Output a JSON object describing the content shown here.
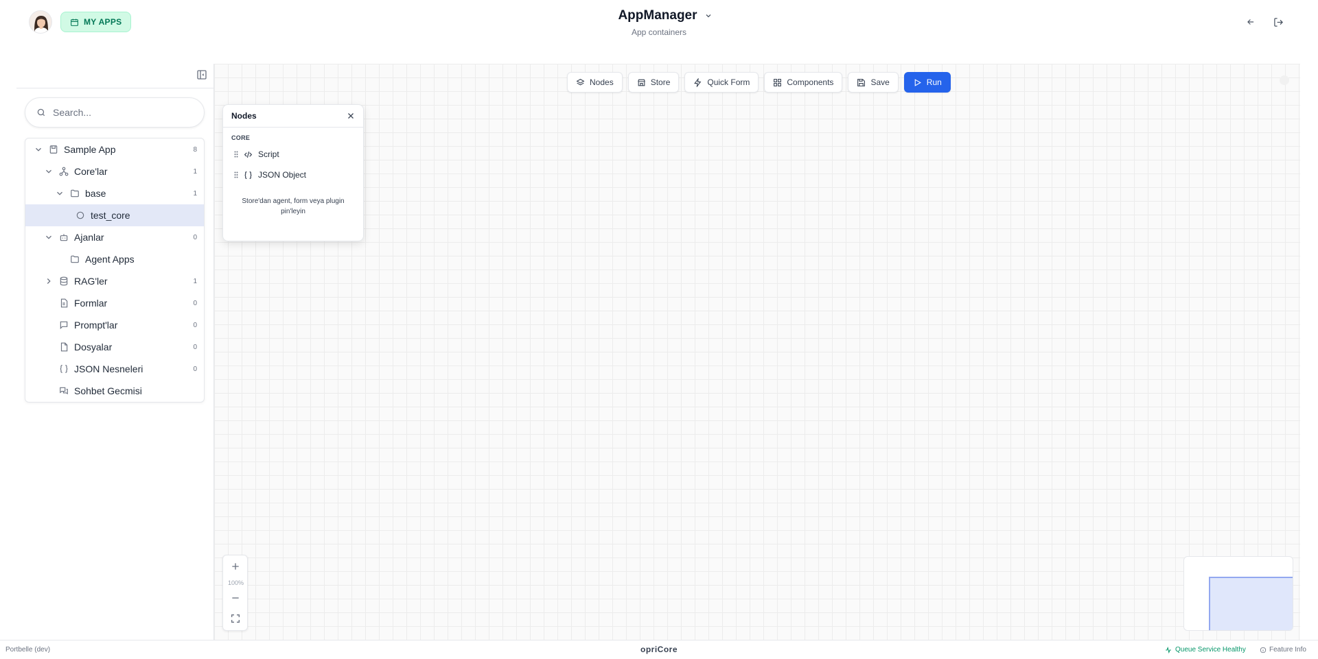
{
  "header": {
    "my_apps_label": "MY APPS",
    "title": "AppManager",
    "subtitle": "App containers"
  },
  "sidebar": {
    "search_placeholder": "Search...",
    "tree": [
      {
        "label": "Sample App",
        "count": "8",
        "icon": "app-icon",
        "expanded": true
      },
      {
        "label": "Core'lar",
        "count": "1",
        "icon": "network-icon",
        "expanded": true
      },
      {
        "label": "base",
        "count": "1",
        "icon": "folder-icon",
        "expanded": true
      },
      {
        "label": "test_core",
        "count": "",
        "icon": "circle-icon",
        "selected": true
      },
      {
        "label": "Ajanlar",
        "count": "0",
        "icon": "bot-icon",
        "expanded": true
      },
      {
        "label": "Agent Apps",
        "count": "",
        "icon": "folder-icon"
      },
      {
        "label": "RAG'ler",
        "count": "1",
        "icon": "database-icon",
        "expanded": false
      },
      {
        "label": "Formlar",
        "count": "0",
        "icon": "form-icon"
      },
      {
        "label": "Prompt'lar",
        "count": "0",
        "icon": "message-icon"
      },
      {
        "label": "Dosyalar",
        "count": "0",
        "icon": "file-icon"
      },
      {
        "label": "JSON Nesneleri",
        "count": "0",
        "icon": "braces-icon"
      },
      {
        "label": "Sohbet Gecmisi",
        "count": "",
        "icon": "chat-icon"
      }
    ]
  },
  "toolbar": {
    "nodes": "Nodes",
    "store": "Store",
    "quick_form": "Quick Form",
    "components": "Components",
    "save": "Save",
    "run": "Run"
  },
  "nodes_panel": {
    "title": "Nodes",
    "section": "CORE",
    "items": [
      "Script",
      "JSON Object"
    ],
    "hint": "Store'dan agent, form veya plugin pin'leyin"
  },
  "zoom": {
    "level": "100%"
  },
  "footer": {
    "env": "Portbelle (dev)",
    "brand": "opriCore",
    "status": "Queue Service Healthy",
    "info": "Feature Info"
  },
  "colors": {
    "accent": "#2563eb",
    "my_apps_bg": "#d1fae5",
    "my_apps_text": "#047857",
    "selected_row": "#e3e8f7",
    "status_ok": "#059669"
  }
}
